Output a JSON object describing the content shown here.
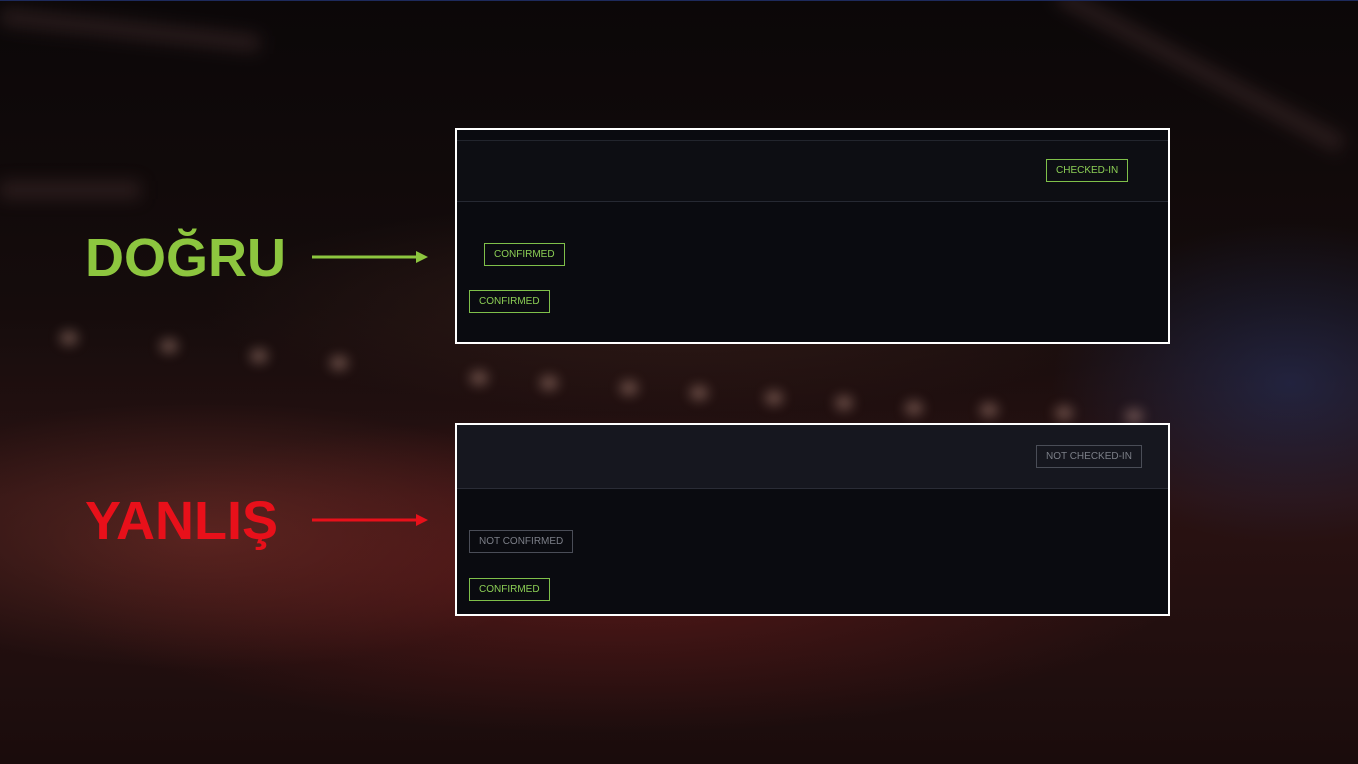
{
  "labels": {
    "correct": "DOĞRU",
    "wrong": "YANLIŞ"
  },
  "colors": {
    "correct": "#8dc63f",
    "wrong": "#e8101a",
    "badge_green": "#8ccf55",
    "badge_gray": "#7c7f88",
    "panel_border": "#ffffff"
  },
  "correct_panel": {
    "header_badge": "CHECKED-IN",
    "badge_1": "CONFIRMED",
    "badge_2": "CONFIRMED"
  },
  "wrong_panel": {
    "header_badge": "NOT CHECKED-IN",
    "badge_1": "NOT CONFIRMED",
    "badge_2": "CONFIRMED"
  }
}
